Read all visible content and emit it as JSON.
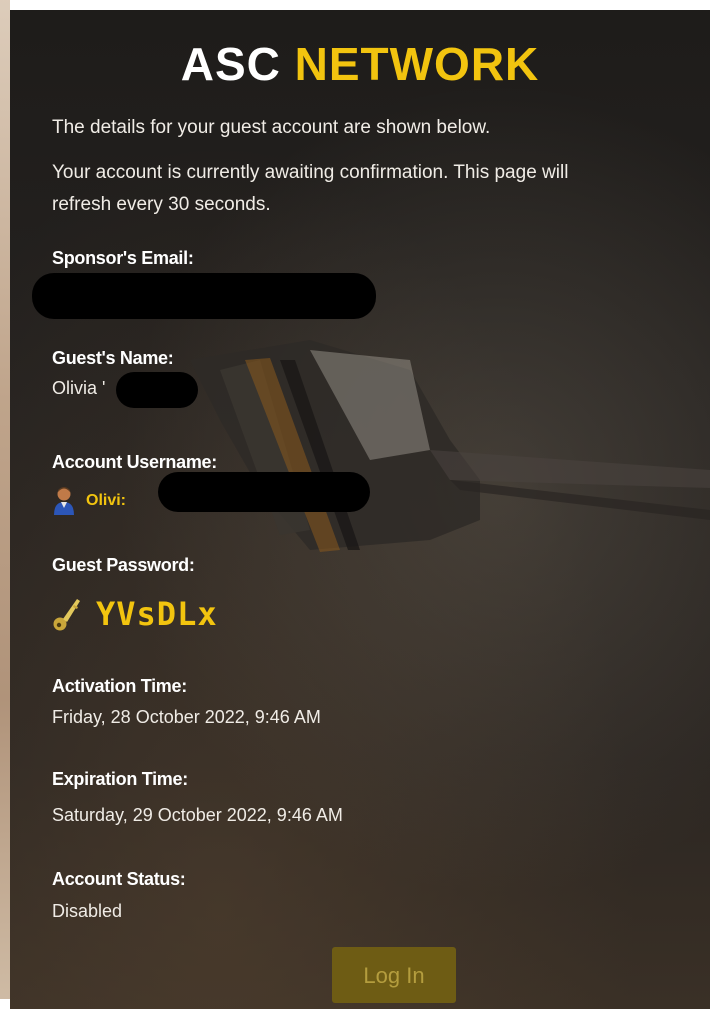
{
  "header": {
    "title_part1": "ASC",
    "title_part2": "NETWORK"
  },
  "intro": {
    "line1": "The details for your guest account are shown below.",
    "line2": "Your account is currently awaiting confirmation. This page will",
    "line3": "refresh every 30 seconds."
  },
  "sponsor": {
    "label": "Sponsor's Email:"
  },
  "guest_name": {
    "label": "Guest's Name:",
    "value": "Olivia '"
  },
  "username": {
    "label": "Account Username:",
    "value": "Olivi:",
    "icon": "user-icon"
  },
  "password": {
    "label": "Guest Password:",
    "value": "YVsDLx",
    "icon": "key-icon"
  },
  "activation": {
    "label": "Activation Time:",
    "value": "Friday, 28 October 2022, 9:46 AM"
  },
  "expiration": {
    "label": "Expiration Time:",
    "value": "Saturday, 29 October 2022, 9:46 AM"
  },
  "status": {
    "label": "Account Status:",
    "value": "Disabled"
  },
  "actions": {
    "login_label": "Log In"
  },
  "colors": {
    "accent": "#f2c40f",
    "button_bg": "#6e5c14",
    "background": "#1e1c1a"
  }
}
